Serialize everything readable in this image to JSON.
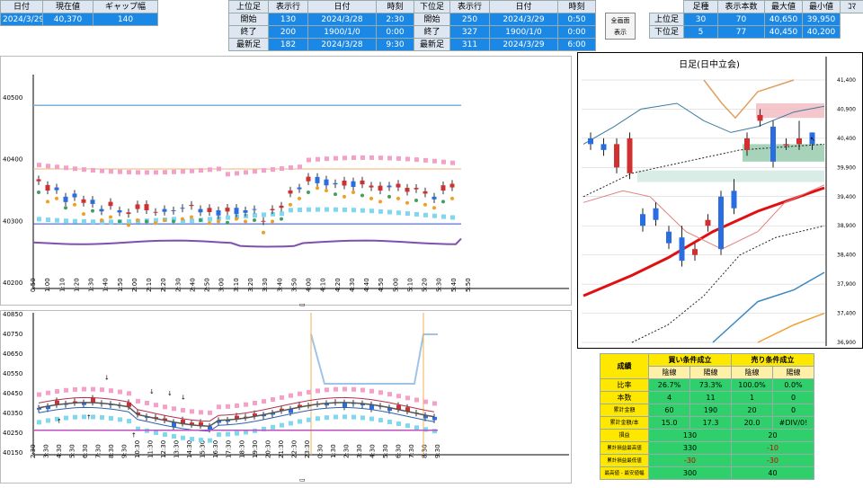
{
  "header": {
    "date_label": "日付",
    "date_value": "2024/3/29",
    "price_label": "現在値",
    "price_value": "40,370",
    "gap_label": "ギャップ幅",
    "gap_value": "140"
  },
  "upper_table": {
    "h1": "上位足",
    "h2": "表示行",
    "h3": "日付",
    "h4": "時刻",
    "rows": [
      {
        "label": "開始",
        "row": "130",
        "date": "2024/3/28",
        "time": "2:30"
      },
      {
        "label": "終了",
        "row": "200",
        "date": "1900/1/0",
        "time": "0:00"
      },
      {
        "label": "最新足",
        "row": "182",
        "date": "2024/3/28",
        "time": "9:30"
      }
    ]
  },
  "lower_table": {
    "h1": "下位足",
    "h2": "表示行",
    "h3": "日付",
    "h4": "時刻",
    "rows": [
      {
        "label": "開始",
        "row": "250",
        "date": "2024/3/29",
        "time": "0:50"
      },
      {
        "label": "終了",
        "row": "327",
        "date": "1900/1/0",
        "time": "0:00"
      },
      {
        "label": "最新足",
        "row": "311",
        "date": "2024/3/29",
        "time": "6:00"
      }
    ]
  },
  "fullscreen_button": {
    "line1": "全画面",
    "line2": "表示"
  },
  "summary_table": {
    "h1": "足種",
    "h2": "表示本数",
    "h3": "最大値",
    "h4": "最小値",
    "h5": "ｺﾏ",
    "rows": [
      {
        "label": "上位足",
        "count": "70",
        "max": "40,650",
        "min": "39,950",
        "lead": "30"
      },
      {
        "label": "下位足",
        "count": "77",
        "max": "40,450",
        "min": "40,200",
        "lead": "5"
      }
    ]
  },
  "stats": {
    "title": "成績",
    "buy": "買い条件成立",
    "sell": "売り条件成立",
    "neg": "陰線",
    "pos": "陽線",
    "rows": [
      {
        "label": "比率",
        "v": [
          "26.7%",
          "73.3%",
          "100.0%",
          "0.0%"
        ]
      },
      {
        "label": "本数",
        "v": [
          "4",
          "11",
          "1",
          "0"
        ]
      },
      {
        "label": "累計金額",
        "v": [
          "60",
          "190",
          "20",
          "0"
        ]
      },
      {
        "label": "累計金額/本",
        "v": [
          "15.0",
          "17.3",
          "20.0",
          "#DIV/0!"
        ]
      },
      {
        "label": "損益",
        "v": [
          "130",
          "20"
        ]
      },
      {
        "label": "累計損益最高値",
        "v": [
          "330",
          "-10"
        ]
      },
      {
        "label": "累計損益最低値",
        "v": [
          "-30",
          "-30"
        ]
      },
      {
        "label": "最高値 - 最安値幅",
        "v": [
          "300",
          "40"
        ]
      }
    ]
  },
  "charts": {
    "top": {
      "y_ticks": [
        "40500",
        "40400",
        "40300",
        "40200"
      ],
      "x_ticks": [
        "0:50",
        "1:00",
        "1:10",
        "1:20",
        "1:30",
        "1:40",
        "1:50",
        "2:00",
        "2:10",
        "2:20",
        "2:30",
        "2:40",
        "2:50",
        "3:00",
        "3:10",
        "3:20",
        "3:30",
        "3:40",
        "3:50",
        "4:00",
        "4:10",
        "4:20",
        "4:30",
        "4:40",
        "4:50",
        "5:00",
        "5:10",
        "5:20",
        "5:30",
        "5:40",
        "5:50"
      ]
    },
    "bottom": {
      "y_ticks": [
        "40850",
        "40750",
        "40650",
        "40550",
        "40450",
        "40350",
        "40250",
        "40150"
      ],
      "x_ticks": [
        "2:30",
        "3:30",
        "4:30",
        "5:30",
        "6:30",
        "7:30",
        "8:30",
        "9:30",
        "10:30",
        "11:30",
        "12:30",
        "13:30",
        "14:30",
        "15:30",
        "16:30",
        "17:30",
        "18:30",
        "19:30",
        "20:30",
        "21:30",
        "22:30",
        "23:30",
        "0:30",
        "1:30",
        "2:30",
        "3:30",
        "4:30",
        "5:30",
        "6:30",
        "7:30",
        "8:30",
        "9:30"
      ]
    },
    "daily": {
      "title": "日足(日中立会)",
      "y_ticks": [
        "41,400",
        "40,900",
        "40,400",
        "39,900",
        "39,400",
        "38,900",
        "38,400",
        "37,900",
        "37,400",
        "36,900"
      ]
    }
  },
  "colors": {
    "header_blue": "#1c88e6",
    "yellow": "#ffe800",
    "green": "#2fd06c",
    "ma_red": "#e01010",
    "pink": "#f5a0c8",
    "cyan": "#7fd8f0"
  }
}
